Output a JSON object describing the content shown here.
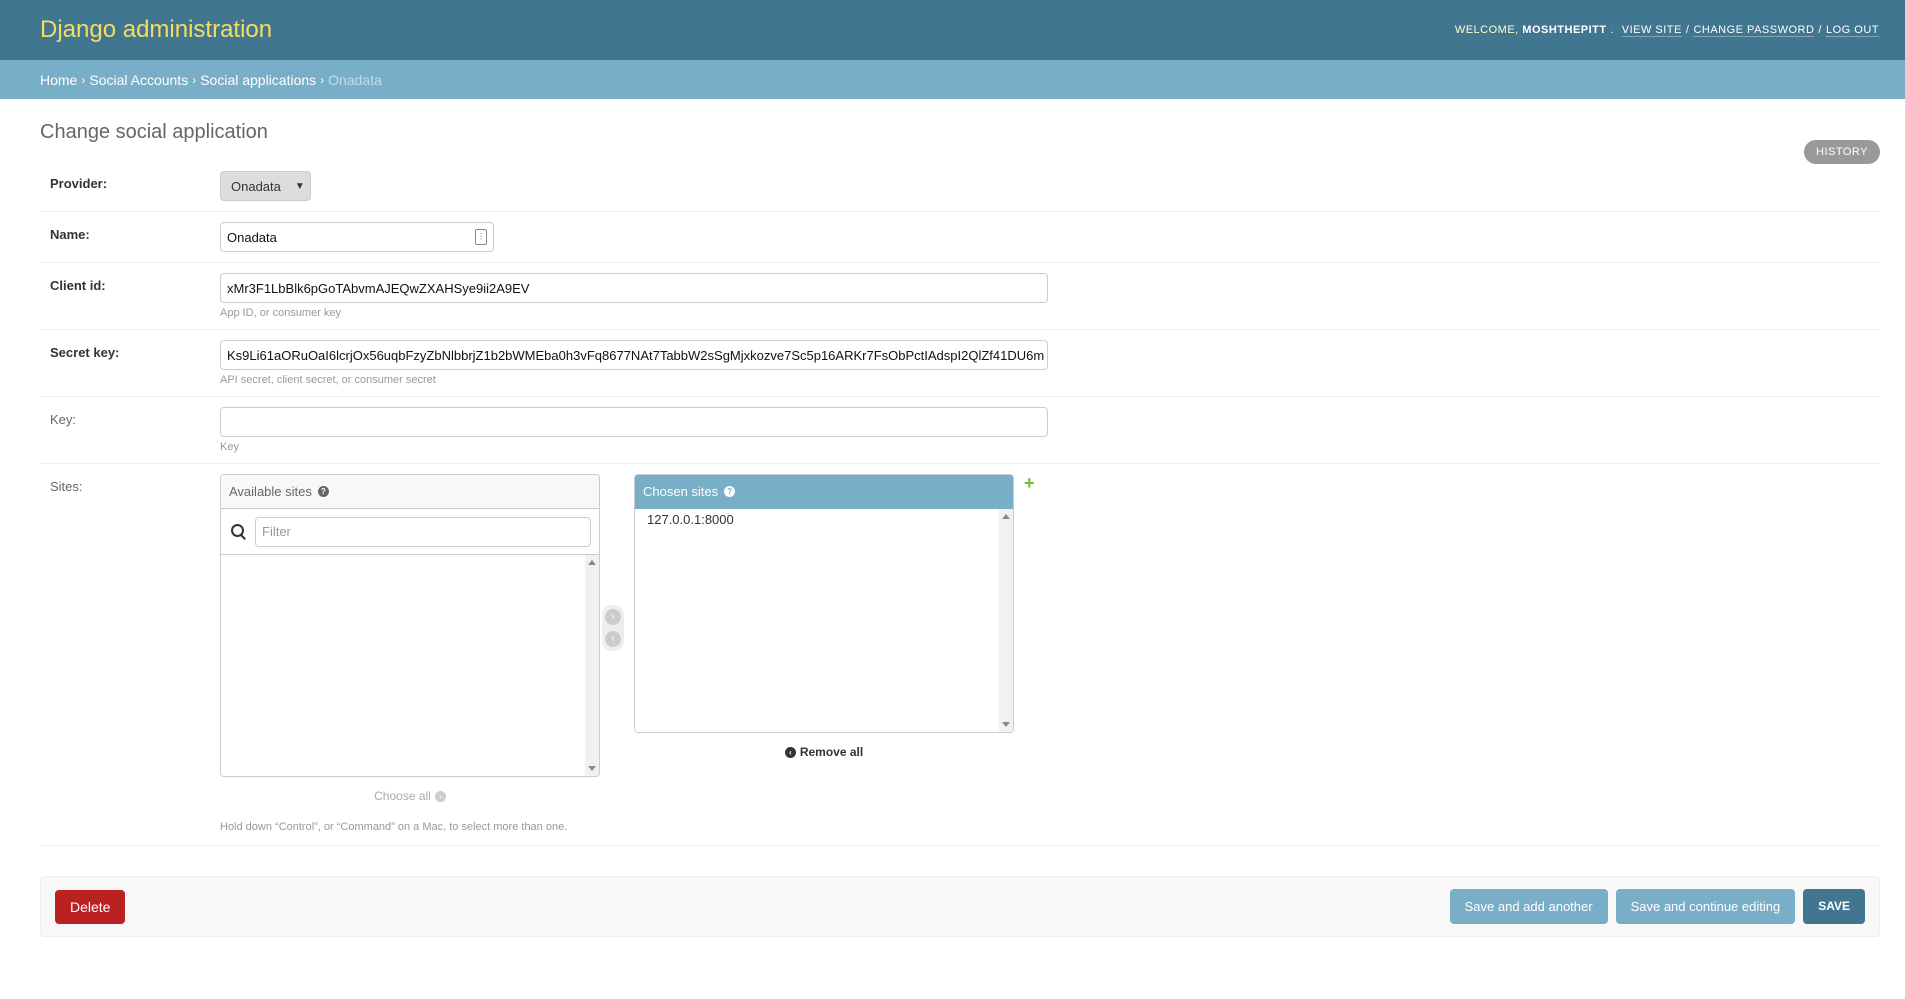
{
  "header": {
    "branding": "Django administration",
    "welcome": "Welcome,",
    "username": "moshthepitt",
    "view_site": "View site",
    "change_password": "Change password",
    "log_out": "Log out"
  },
  "breadcrumbs": {
    "home": "Home",
    "app": "Social Accounts",
    "model": "Social applications",
    "current": "Onadata"
  },
  "page": {
    "title": "Change social application",
    "history": "History"
  },
  "form": {
    "provider": {
      "label": "Provider:",
      "value": "Onadata"
    },
    "name": {
      "label": "Name:",
      "value": "Onadata"
    },
    "client_id": {
      "label": "Client id:",
      "value": "xMr3F1LbBlk6pGoTAbvmAJEQwZXAHSye9ii2A9EV",
      "help": "App ID, or consumer key"
    },
    "secret_key": {
      "label": "Secret key:",
      "value": "Ks9Li61aORuOaI6lcrjOx56uqbFzyZbNlbbrjZ1b2bWMEba0h3vFq8677NAt7TabbW2sSgMjxkozve7Sc5p16ARKr7FsObPctIAdspI2QlZf41DU6m",
      "help": "API secret, client secret, or consumer secret"
    },
    "key": {
      "label": "Key:",
      "value": "",
      "help": "Key"
    },
    "sites": {
      "label": "Sites:",
      "available_title": "Available sites",
      "filter_placeholder": "Filter",
      "available": [],
      "chosen_title": "Chosen sites",
      "chosen": [
        "127.0.0.1:8000"
      ],
      "choose_all": "Choose all",
      "remove_all": "Remove all",
      "add_icon": "+",
      "help": "Hold down “Control”, or “Command” on a Mac, to select more than one."
    }
  },
  "submit": {
    "delete": "Delete",
    "save_add_another": "Save and add another",
    "save_continue": "Save and continue editing",
    "save": "Save"
  },
  "colors": {
    "header_bg": "#417690",
    "breadcrumbs_bg": "#79aec8",
    "branding": "#f5dd5d",
    "delete": "#ba2121",
    "add": "#70bf2b"
  }
}
